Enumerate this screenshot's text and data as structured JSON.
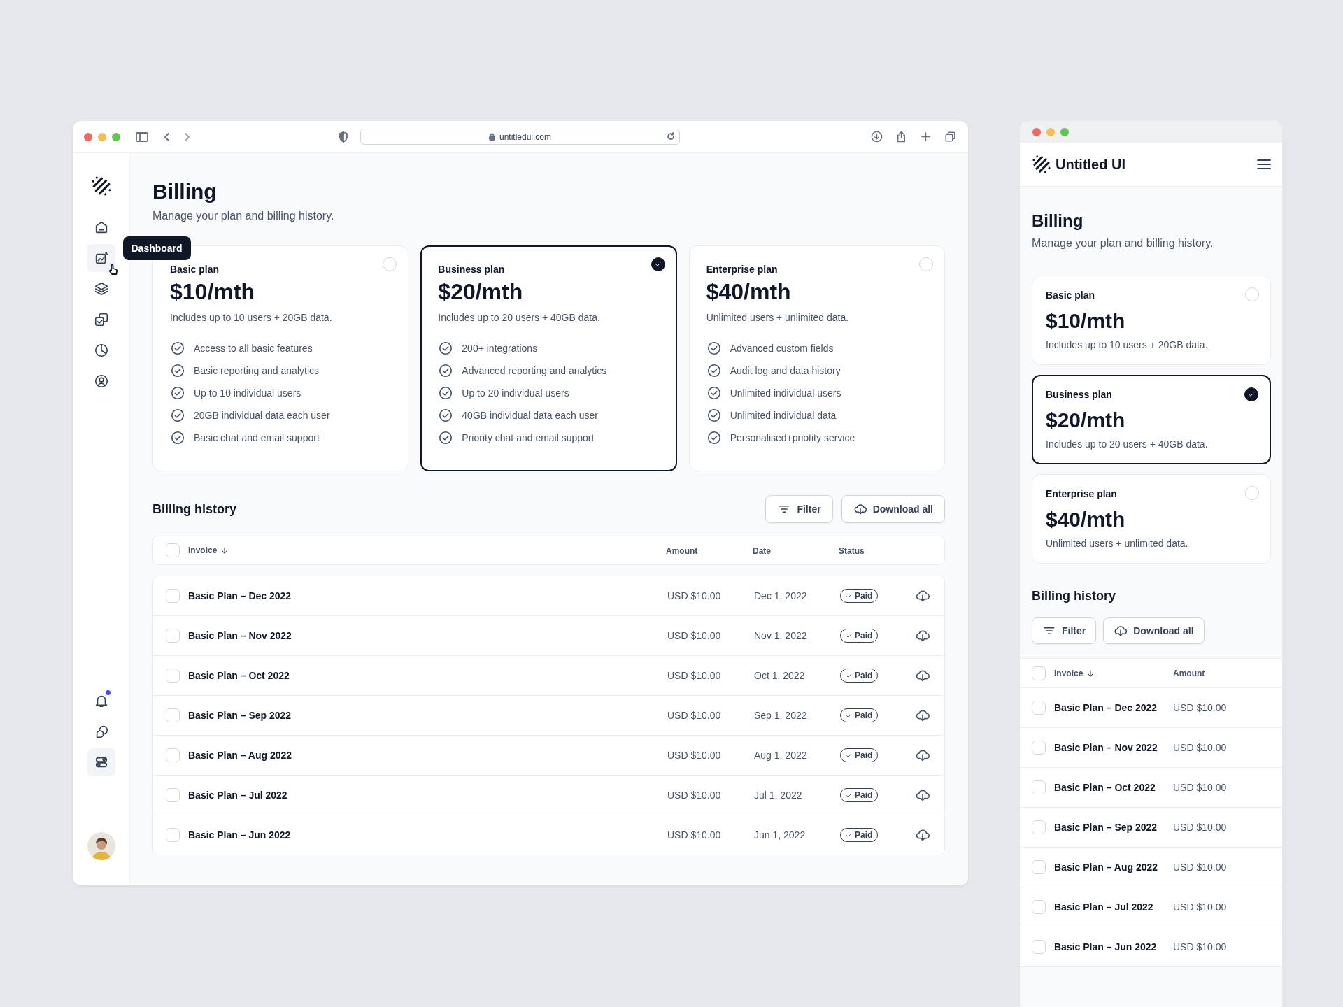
{
  "desktop": {
    "browser": {
      "url": "untitledui.com"
    },
    "nav": {
      "top": [
        {
          "selected": false
        },
        {
          "selected": true
        },
        {
          "selected": false
        },
        {
          "selected": false
        },
        {
          "selected": false
        },
        {
          "selected": false
        }
      ],
      "bottom": [
        {
          "selected": false,
          "unread": true
        },
        {
          "selected": false,
          "unread": false
        },
        {
          "selected": true,
          "unread": false
        }
      ]
    },
    "tooltip": "Dashboard",
    "title": "Billing",
    "subtitle": "Manage your plan and billing history.",
    "plans": [
      {
        "name": "Basic plan",
        "price": "$10/mth",
        "description": "Includes up to 10 users + 20GB data.",
        "selected": false,
        "features": [
          "Access to all basic features",
          "Basic reporting and analytics",
          "Up to 10 individual users",
          "20GB individual data each user",
          "Basic chat and email support"
        ]
      },
      {
        "name": "Business plan",
        "price": "$20/mth",
        "description": "Includes up to 20 users + 40GB data.",
        "selected": true,
        "features": [
          "200+ integrations",
          "Advanced reporting and analytics",
          "Up to 20 individual users",
          "40GB individual data each user",
          "Priority chat and email support"
        ]
      },
      {
        "name": "Enterprise plan",
        "price": "$40/mth",
        "description": "Unlimited users + unlimited data.",
        "selected": false,
        "features": [
          "Advanced custom fields",
          "Audit log and data history",
          "Unlimited individual users",
          "Unlimited individual data",
          "Personalised+priotity service"
        ]
      }
    ],
    "history": {
      "title": "Billing history",
      "buttons": [
        {
          "label": "Filter",
          "kind": "filter"
        },
        {
          "label": "Download all",
          "kind": "download"
        }
      ],
      "header_checked": false,
      "columns": [
        "Invoice",
        "Amount",
        "Date",
        "Status"
      ],
      "rows": [
        {
          "invoice": "Basic Plan – Dec 2022",
          "amount": "USD $10.00",
          "date": "Dec 1, 2022",
          "status": "Paid",
          "checked": false
        },
        {
          "invoice": "Basic Plan – Nov 2022",
          "amount": "USD $10.00",
          "date": "Nov 1, 2022",
          "status": "Paid",
          "checked": false
        },
        {
          "invoice": "Basic Plan – Oct 2022",
          "amount": "USD $10.00",
          "date": "Oct 1, 2022",
          "status": "Paid",
          "checked": false
        },
        {
          "invoice": "Basic Plan – Sep 2022",
          "amount": "USD $10.00",
          "date": "Sep 1, 2022",
          "status": "Paid",
          "checked": false
        },
        {
          "invoice": "Basic Plan – Aug 2022",
          "amount": "USD $10.00",
          "date": "Aug 1, 2022",
          "status": "Paid",
          "checked": false
        },
        {
          "invoice": "Basic Plan – Jul 2022",
          "amount": "USD $10.00",
          "date": "Jul 1, 2022",
          "status": "Paid",
          "checked": false
        },
        {
          "invoice": "Basic Plan – Jun 2022",
          "amount": "USD $10.00",
          "date": "Jun 1, 2022",
          "status": "Paid",
          "checked": false
        }
      ]
    }
  },
  "mobile": {
    "brand": "Untitled UI",
    "title": "Billing",
    "subtitle": "Manage your plan and billing history.",
    "plans": [
      {
        "name": "Basic plan",
        "price": "$10/mth",
        "description": "Includes up to 10 users + 20GB data.",
        "selected": false
      },
      {
        "name": "Business plan",
        "price": "$20/mth",
        "description": "Includes up to 20 users + 40GB data.",
        "selected": true
      },
      {
        "name": "Enterprise plan",
        "price": "$40/mth",
        "description": "Unlimited users + unlimited data.",
        "selected": false
      }
    ],
    "history": {
      "title": "Billing history",
      "buttons": [
        {
          "label": "Filter",
          "kind": "filter"
        },
        {
          "label": "Download all",
          "kind": "download"
        }
      ],
      "header_checked": false,
      "columns": [
        "Invoice",
        "Amount"
      ],
      "rows": [
        {
          "invoice": "Basic Plan – Dec 2022",
          "amount": "USD $10.00",
          "checked": false
        },
        {
          "invoice": "Basic Plan – Nov 2022",
          "amount": "USD $10.00",
          "checked": false
        },
        {
          "invoice": "Basic Plan – Oct 2022",
          "amount": "USD $10.00",
          "checked": false
        },
        {
          "invoice": "Basic Plan – Sep 2022",
          "amount": "USD $10.00",
          "checked": false
        },
        {
          "invoice": "Basic Plan – Aug 2022",
          "amount": "USD $10.00",
          "checked": false
        },
        {
          "invoice": "Basic Plan – Jul 2022",
          "amount": "USD $10.00",
          "checked": false
        },
        {
          "invoice": "Basic Plan – Jun 2022",
          "amount": "USD $10.00",
          "checked": false
        }
      ]
    }
  }
}
